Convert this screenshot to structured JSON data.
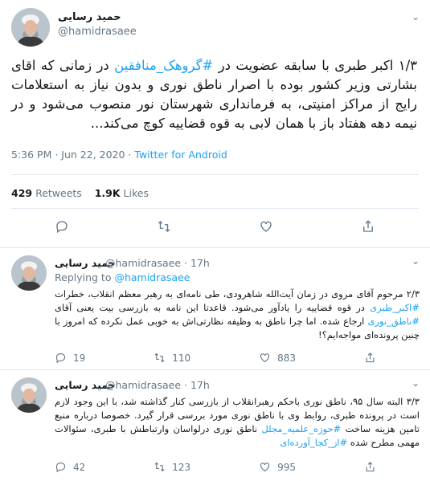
{
  "main": {
    "name": "حمید رسایی",
    "handle": "@hamidrasaee",
    "text_before": "۱/۳ اکبر طبری با سابقه عضویت در ",
    "hashtag": "#گروهک_منافقین",
    "text_after": " در زمانی که اقای بشارتی وزیر کشور بوده با اصرار ناطق نوری و بدون نیاز به استعلامات رایج از مراکز امنیتی، به فرمانداری شهرستان نور منصوب می‌شود و در نیمه دهه هفتاد باز با همان لابی به قوه قضاییه کوچ می‌کند...",
    "time": "5:36 PM · Jun 22, 2020 · ",
    "source": "Twitter for Android",
    "retweets_count": "429",
    "retweets_label": "Retweets",
    "likes_count": "1.9K",
    "likes_label": "Likes"
  },
  "replies": [
    {
      "name": "حمید رسایی",
      "handle": "@hamidrasaee · 17h",
      "replying_prefix": "Replying to ",
      "replying_to": "@hamidrasaee",
      "p1": "۲/۳ مرحوم آقای مروی در زمان آیت‌الله شاهرودی، طی نامه‌ای به رهبر معظم انقلاب، خطرات ",
      "h1": "#اکبر_طبری",
      "p2": " در قوه قضاییه را یادآور می‌شود. قاعدتا این نامه به بازرسی بیت یعنی آقای ",
      "h2": "#ناطق_نوری",
      "p3": " ارجاع شده. اما چرا ناطق به وظیفه نظارتی‌اش به خوبی عمل نکرده که امروز با چنین پرونده‌ای مواجه‌ایم؟!",
      "reply_count": "19",
      "retweet_count": "110",
      "like_count": "883"
    },
    {
      "name": "حمید رسایی",
      "handle": "@hamidrasaee · 17h",
      "p1": "۳/۳ البته سال ۹۵، ناطق نوری باحکم رهبرانقلاب از بازرسی کنار گذاشته شد، با این وجود لازم است در پرونده طبری، روابط وی با ناطق نوری مورد بررسی قرار گیرد. خصوصا درباره منبع تامین هزینه ساخت ",
      "h1": "#حوزه_علمیه_مجلل",
      "p2": " ناطق نوری درلواسان وارتباطش با طبری، سئوالات مهمی مطرح شده ",
      "h2": "#از_کجا_آورده‌ای",
      "reply_count": "42",
      "retweet_count": "123",
      "like_count": "995"
    }
  ]
}
